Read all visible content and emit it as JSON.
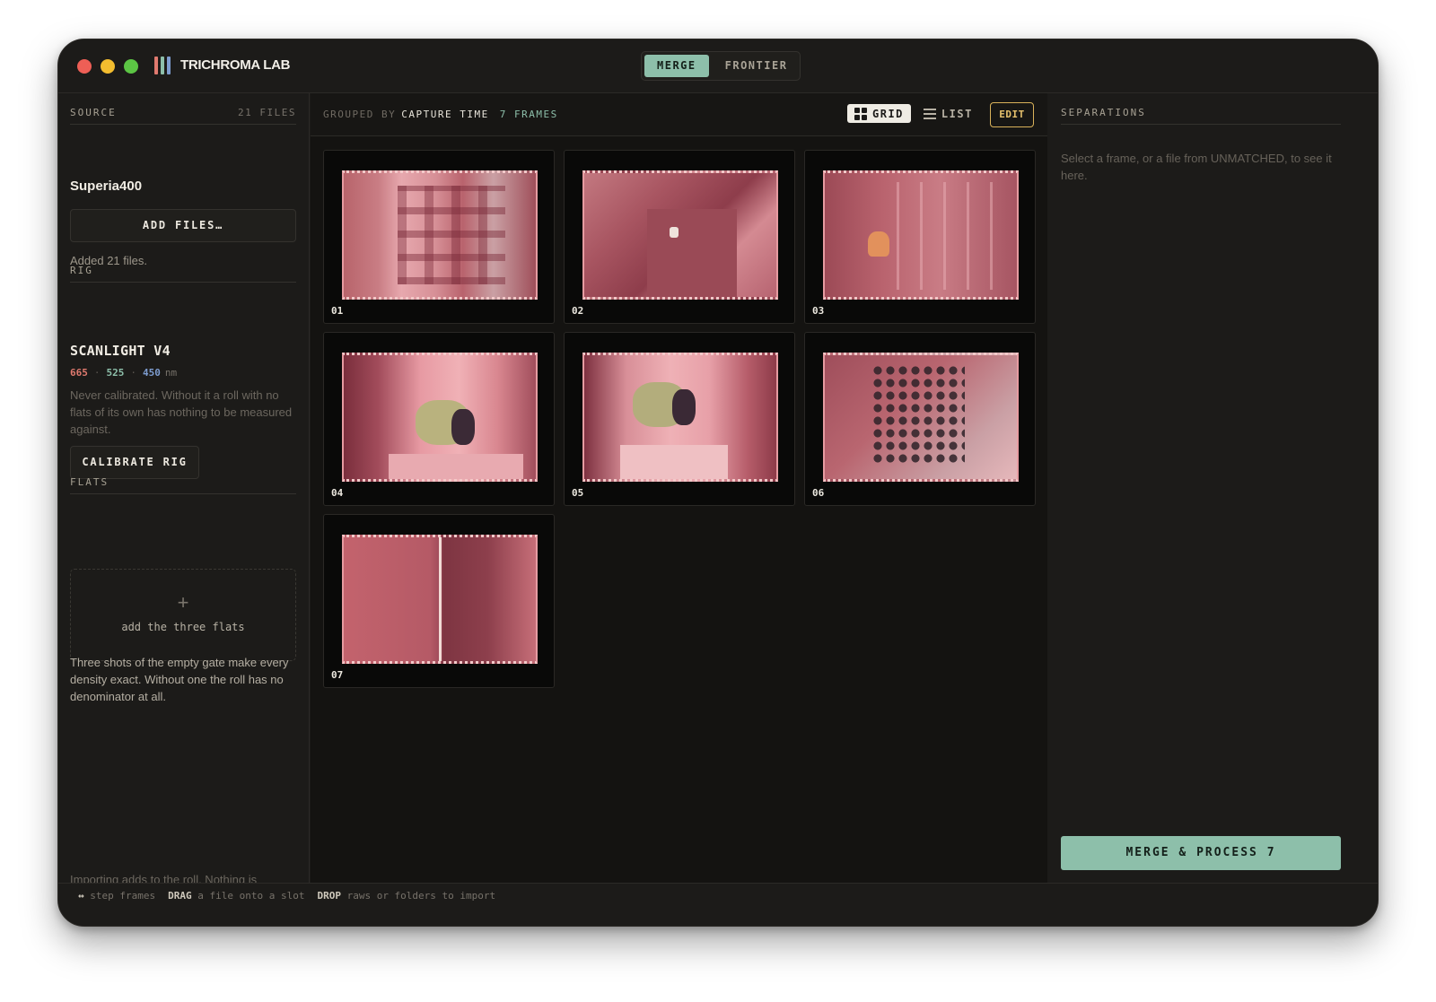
{
  "titlebar": {
    "app_title": "TRICHROMA LAB",
    "logo_colors": [
      "#e07a6f",
      "#8dbfaa",
      "#7d9ccf"
    ],
    "tabs": [
      {
        "label": "MERGE",
        "active": true
      },
      {
        "label": "FRONTIER",
        "active": false
      }
    ]
  },
  "sidebar": {
    "source": {
      "heading": "SOURCE",
      "file_count": "21 FILES",
      "roll_name": "Superia400",
      "add_button": "ADD FILES…",
      "status": "Added 21 files."
    },
    "rig": {
      "heading": "RIG",
      "name": "SCANLIGHT V4",
      "wavelengths": [
        {
          "value": "665",
          "color": "#e07a6f"
        },
        {
          "value": "525",
          "color": "#8dbfaa"
        },
        {
          "value": "450",
          "color": "#7d9ccf"
        }
      ],
      "unit": "nm",
      "separator": "·",
      "note": "Never calibrated. Without it a roll with no flats of its own has nothing to be measured against.",
      "calibrate_button": "CALIBRATE RIG"
    },
    "flats": {
      "heading": "FLATS",
      "drop_icon": "plus-icon",
      "drop_label": "add the three flats",
      "description": "Three shots of the empty gate make every density exact. Without one the roll has no denominator at all."
    },
    "footer_note": "Importing adds to the roll. Nothing is copied or moved on disk."
  },
  "main": {
    "grouped_label": "GROUPED BY",
    "grouped_value": "CAPTURE TIME",
    "frame_count": "7 FRAMES",
    "views": [
      {
        "label": "GRID",
        "icon": "grid-icon",
        "active": true
      },
      {
        "label": "LIST",
        "icon": "list-icon",
        "active": false
      }
    ],
    "edit_button": "EDIT",
    "frames": [
      {
        "number": "01"
      },
      {
        "number": "02"
      },
      {
        "number": "03"
      },
      {
        "number": "04"
      },
      {
        "number": "05"
      },
      {
        "number": "06"
      },
      {
        "number": "07"
      }
    ]
  },
  "panel": {
    "heading": "SEPARATIONS",
    "hint": "Select a frame, or a file from UNMATCHED, to see it here.",
    "merge_button": "MERGE & PROCESS 7"
  },
  "statusbar": {
    "items": [
      {
        "key": "↔",
        "text": "step frames"
      },
      {
        "key": "DRAG",
        "text": "a file onto a slot"
      },
      {
        "key": "DROP",
        "text": "raws or folders to import"
      }
    ]
  },
  "colors": {
    "accent": "#8dbfaa",
    "edit_accent": "#d9b25a",
    "background": "#1c1b19"
  }
}
